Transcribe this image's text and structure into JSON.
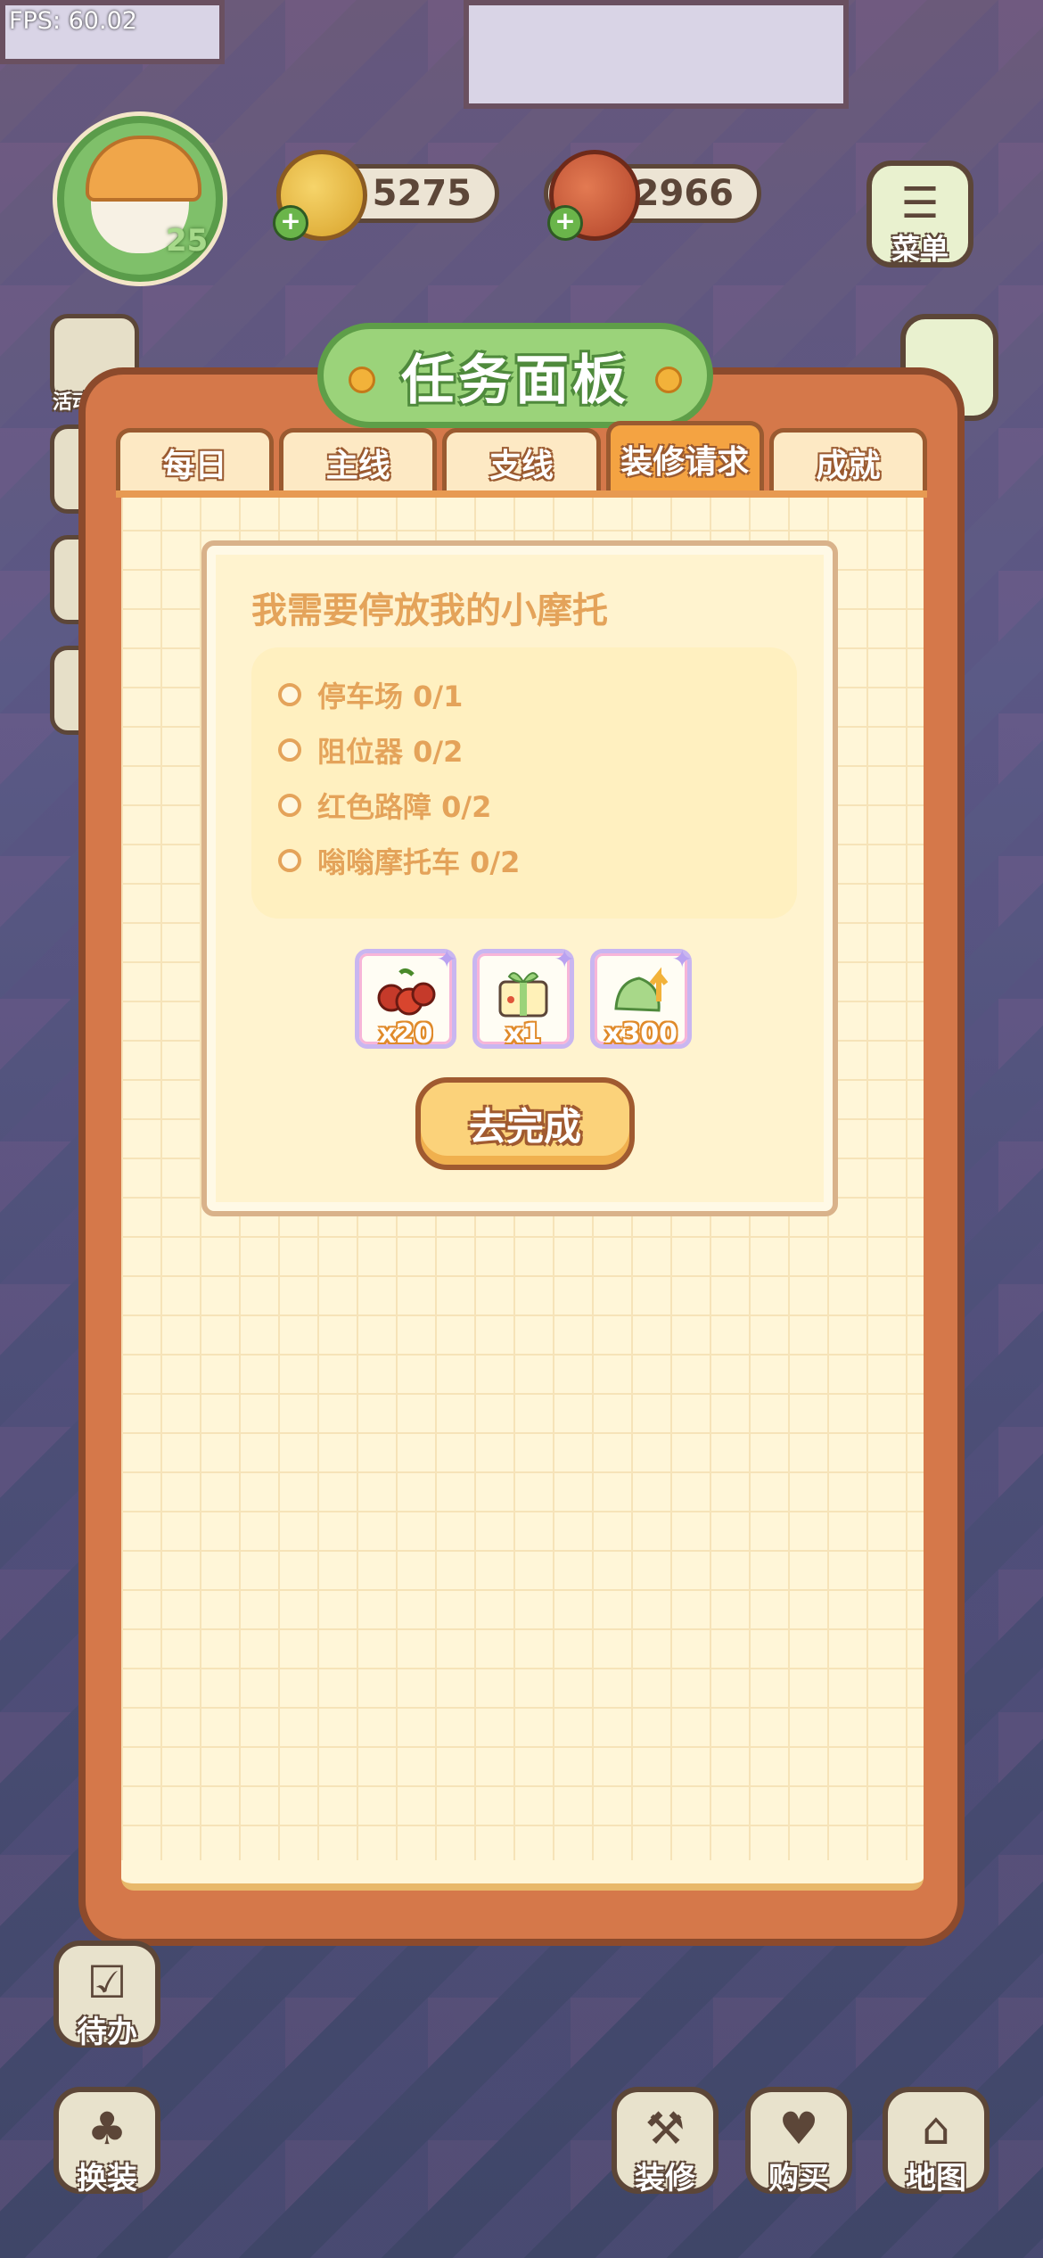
{
  "hud": {
    "fps": "FPS: 60.02",
    "level": "25",
    "coins": "5275",
    "fruit": "2966",
    "menu_label": "菜单"
  },
  "left_side": {
    "activity_label": "活动"
  },
  "panel": {
    "title": "任务面板",
    "tabs": [
      {
        "label": "每日",
        "active": false
      },
      {
        "label": "主线",
        "active": false
      },
      {
        "label": "支线",
        "active": false
      },
      {
        "label": "装修请求",
        "active": true
      },
      {
        "label": "成就",
        "active": false
      }
    ]
  },
  "task": {
    "title": "我需要停放我的小摩托",
    "requirements": [
      {
        "label": "停车场 0/1"
      },
      {
        "label": "阻位器 0/2"
      },
      {
        "label": "红色路障 0/2"
      },
      {
        "label": "嗡嗡摩托车 0/2"
      }
    ],
    "rewards": [
      {
        "icon": "cherries-icon",
        "qty": "x20"
      },
      {
        "icon": "gift-box-icon",
        "qty": "x1"
      },
      {
        "icon": "green-leaf-upgrade-icon",
        "qty": "x300"
      }
    ],
    "go_button": "去完成"
  },
  "bottom": {
    "todo": "待办",
    "dressup": "换装",
    "decorate": "装修",
    "buy": "购买",
    "map": "地图"
  },
  "colors": {
    "panel_frame": "#d5784a",
    "title_green": "#9bd37a",
    "task_text": "#e4a35a"
  }
}
